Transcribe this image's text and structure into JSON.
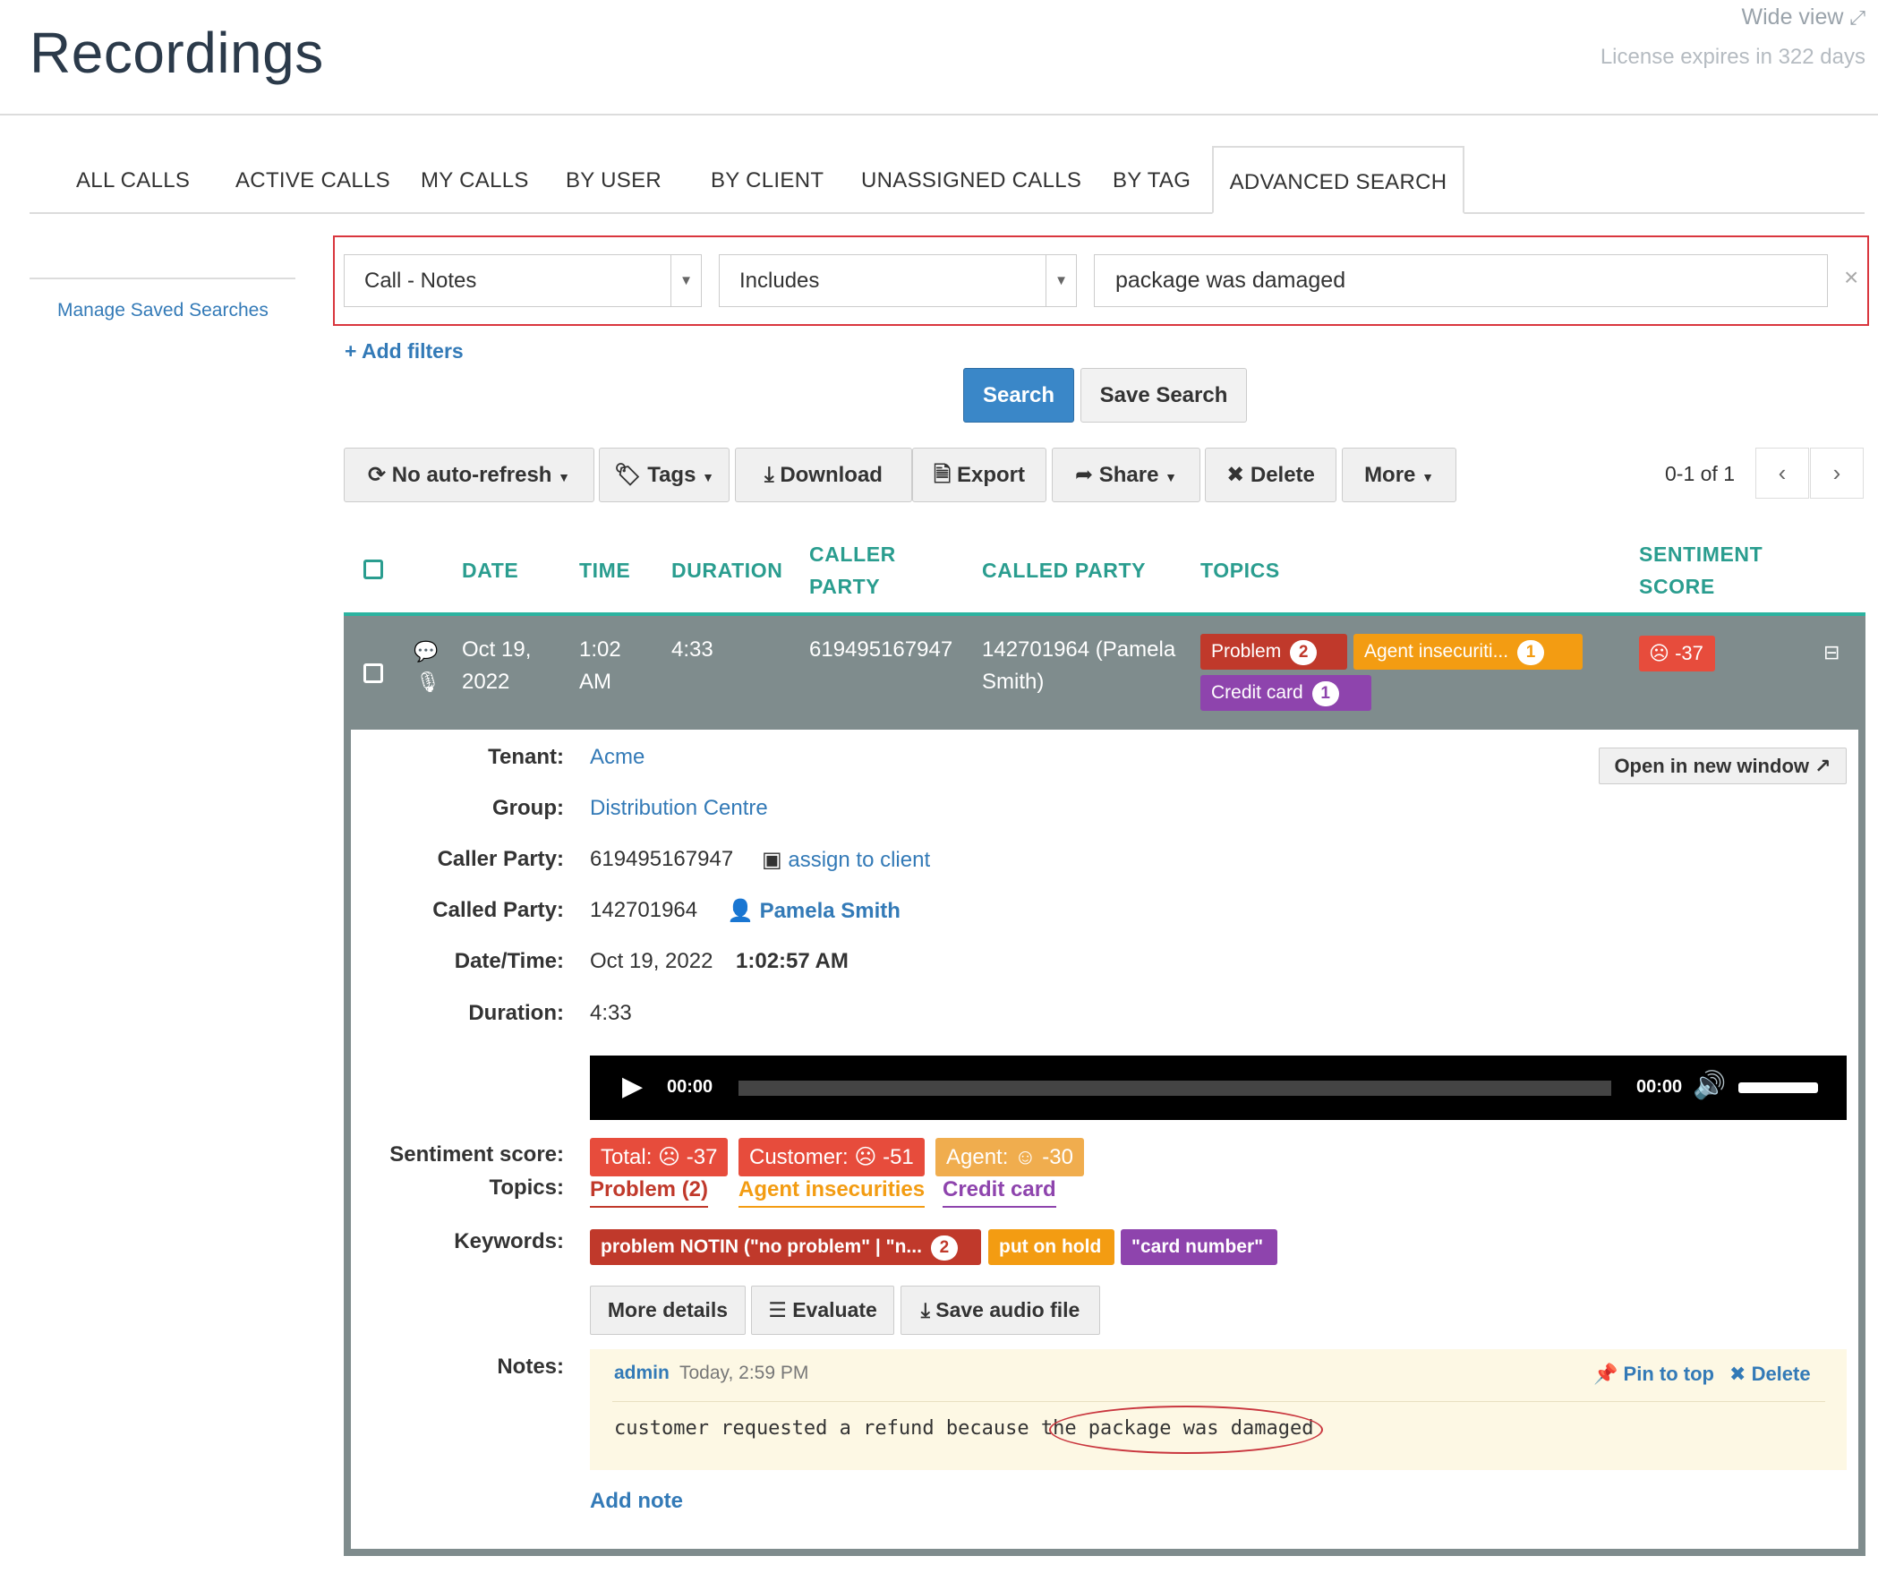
{
  "header": {
    "title": "Recordings",
    "wide_view": "Wide view",
    "license": "License expires in 322 days"
  },
  "tabs": [
    {
      "label": "ALL CALLS"
    },
    {
      "label": "ACTIVE CALLS"
    },
    {
      "label": "MY CALLS"
    },
    {
      "label": "BY USER"
    },
    {
      "label": "BY CLIENT"
    },
    {
      "label": "UNASSIGNED CALLS"
    },
    {
      "label": "BY TAG"
    },
    {
      "label": "ADVANCED SEARCH"
    }
  ],
  "sidebar": {
    "manage_saved": "Manage Saved Searches"
  },
  "filter": {
    "field": "Call - Notes",
    "operator": "Includes",
    "value": "package was damaged",
    "clear": "×",
    "add_filters": "Add filters"
  },
  "actions": {
    "search": "Search",
    "save_search": "Save Search"
  },
  "toolbar": {
    "refresh": "No auto-refresh",
    "tags": "Tags",
    "download": "Download",
    "export": "Export",
    "share": "Share",
    "delete": "Delete",
    "more": "More",
    "pager": "0-1 of 1"
  },
  "table": {
    "headers": {
      "date": "DATE",
      "time": "TIME",
      "duration": "DURATION",
      "caller_1": "CALLER",
      "caller_2": "PARTY",
      "called": "CALLED PARTY",
      "topics": "TOPICS",
      "sent_1": "SENTIMENT",
      "sent_2": "SCORE"
    },
    "row": {
      "date_1": "Oct 19,",
      "date_2": "2022",
      "time_1": "1:02",
      "time_2": "AM",
      "duration": "4:33",
      "caller": "619495167947",
      "called_1": "142701964 (Pamela",
      "called_2": "Smith)",
      "topics": [
        {
          "label": "Problem",
          "count": "2",
          "color": "#c0392b"
        },
        {
          "label": "Agent insecuriti...",
          "count": "1",
          "color": "#f39c12"
        },
        {
          "label": "Credit card",
          "count": "1",
          "color": "#8e44ad"
        }
      ],
      "sentiment": "-37"
    }
  },
  "detail": {
    "open_new": "Open in new window",
    "labels": {
      "tenant": "Tenant:",
      "group": "Group:",
      "caller": "Caller Party:",
      "called": "Called Party:",
      "datetime": "Date/Time:",
      "duration": "Duration:",
      "sentiment": "Sentiment score:",
      "topics": "Topics:",
      "keywords": "Keywords:",
      "notes": "Notes:"
    },
    "tenant": "Acme",
    "group": "Distribution Centre",
    "caller": "619495167947",
    "assign": "assign to client",
    "called": "142701964",
    "called_name": "Pamela Smith",
    "date": "Oct 19, 2022",
    "time": "1:02:57 AM",
    "duration": "4:33",
    "audio": {
      "current": "00:00",
      "total": "00:00",
      "progress": 0,
      "volume": 1.0
    },
    "sentiment": {
      "total": "Total:",
      "total_val": "-37",
      "customer": "Customer:",
      "customer_val": "-51",
      "agent": "Agent:",
      "agent_val": "-30"
    },
    "topics": [
      {
        "label": "Problem (2)",
        "color": "#c0392b"
      },
      {
        "label": "Agent insecurities",
        "color": "#f39c12"
      },
      {
        "label": "Credit card",
        "color": "#8e44ad"
      }
    ],
    "keywords": [
      {
        "label": "problem NOTIN (\"no problem\" | \"n...",
        "count": "2",
        "color": "#c0392b"
      },
      {
        "label": "put on hold",
        "color": "#f39c12"
      },
      {
        "label": "\"card number\"",
        "color": "#8e44ad"
      }
    ],
    "buttons": {
      "more_details": "More details",
      "evaluate": "Evaluate",
      "save_audio": "Save audio file"
    },
    "note": {
      "author": "admin",
      "when": "Today, 2:59 PM",
      "pin": "Pin to top",
      "delete": "Delete",
      "text": "customer requested a refund because the package was damaged"
    },
    "add_note": "Add note"
  }
}
